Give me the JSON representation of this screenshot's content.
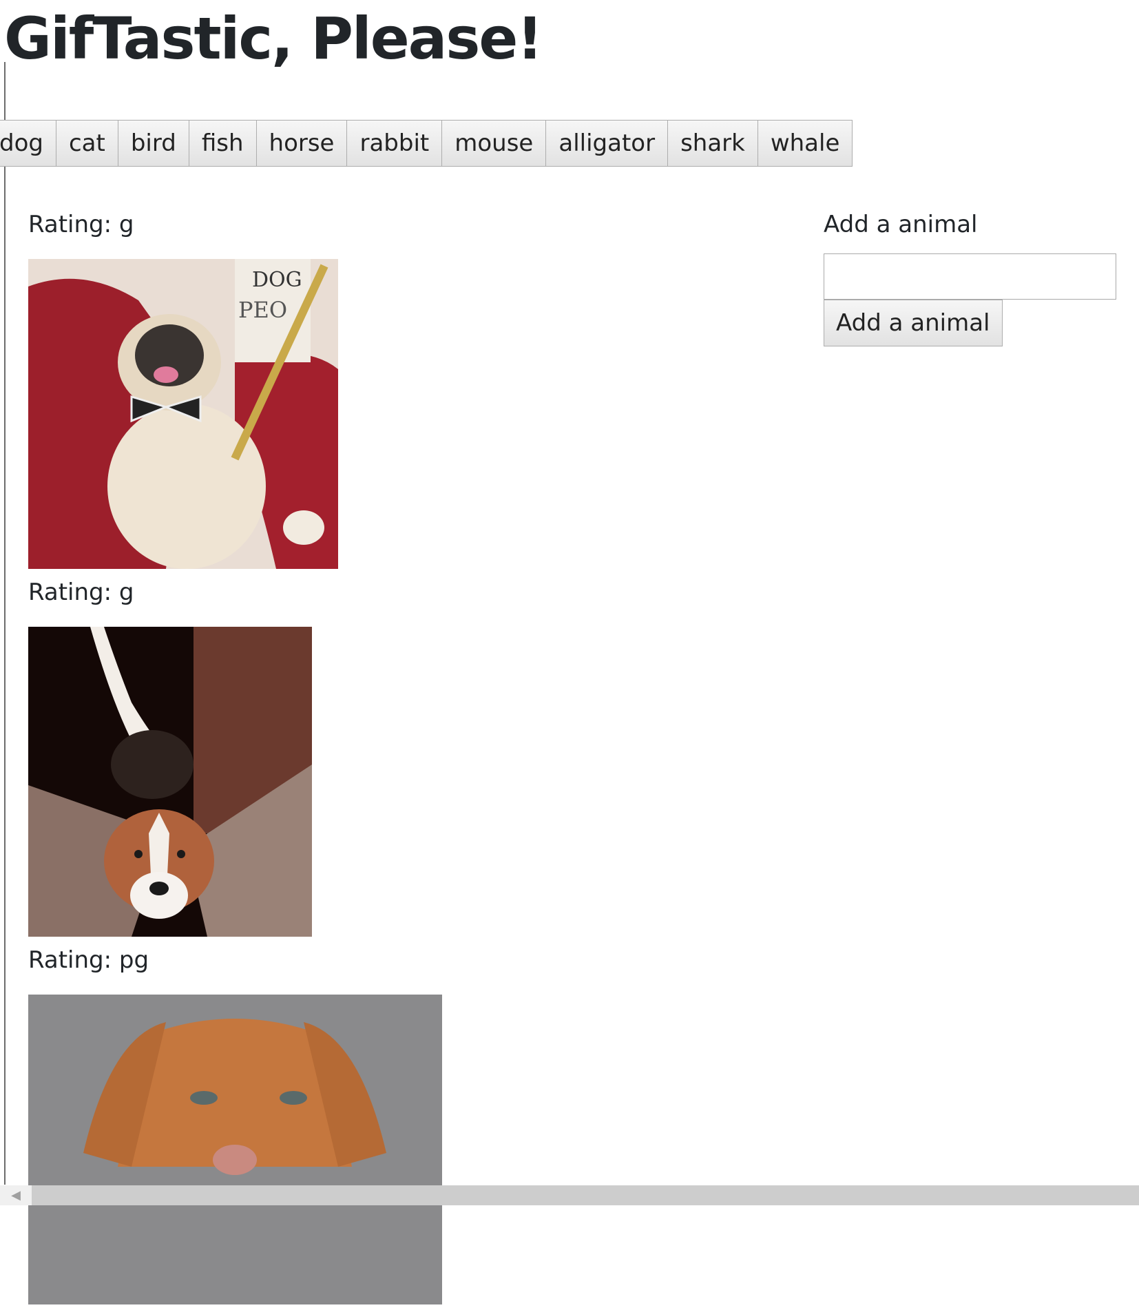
{
  "header": {
    "title": "GifTastic, Please!"
  },
  "animal_buttons": [
    "dog",
    "cat",
    "bird",
    "fish",
    "horse",
    "rabbit",
    "mouse",
    "alligator",
    "shark",
    "whale"
  ],
  "gifs": [
    {
      "rating": "Rating: g",
      "image": "pug-bowtie-gif",
      "width": 450,
      "height": 450
    },
    {
      "rating": "Rating: g",
      "image": "terrier-couch-gif",
      "width": 412,
      "height": 450
    },
    {
      "rating": "Rating: pg",
      "image": "puppy-face-gif",
      "width": 601,
      "height": 450
    }
  ],
  "form": {
    "label": "Add a animal",
    "input_value": "",
    "input_placeholder": "",
    "button_label": "Add a animal"
  },
  "scrollbar": {
    "left_arrow_icon": "scroll-left-arrow-icon"
  }
}
